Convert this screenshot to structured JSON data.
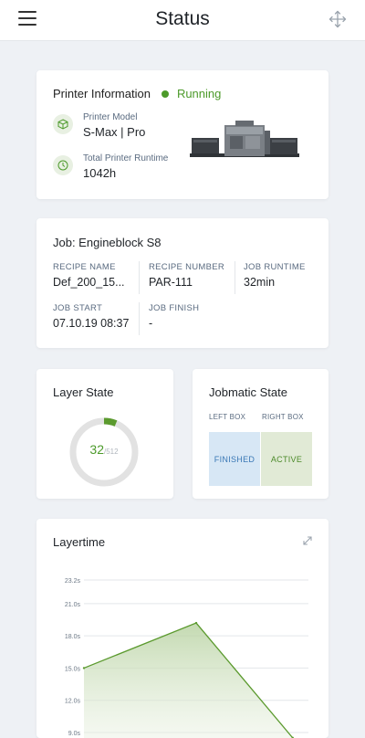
{
  "header": {
    "title": "Status",
    "menu_icon": "hamburger-icon",
    "right_icon": "move-arrows-icon"
  },
  "printer": {
    "title": "Printer Information",
    "status": "Running",
    "status_color": "#4c9a2a",
    "model_label": "Printer Model",
    "model_value": "S-Max | Pro",
    "runtime_label": "Total Printer Runtime",
    "runtime_value": "1042h"
  },
  "job": {
    "title": "Job: Engineblock S8",
    "recipe_name_label": "RECIPE NAME",
    "recipe_name_value": "Def_200_15...",
    "recipe_number_label": "RECIPE NUMBER",
    "recipe_number_value": "PAR-111",
    "job_runtime_label": "JOB RUNTIME",
    "job_runtime_value": "32min",
    "job_start_label": "JOB START",
    "job_start_value": "07.10.19 08:37",
    "job_finish_label": "JOB FINISH",
    "job_finish_value": "-"
  },
  "layer_state": {
    "title": "Layer State",
    "current": "32",
    "total": "/512",
    "progress_fraction": 0.0625
  },
  "jobmatic": {
    "title": "Jobmatic State",
    "left_label": "LEFT BOX",
    "right_label": "RIGHT BOX",
    "left_state": "FINISHED",
    "right_state": "ACTIVE"
  },
  "layertime": {
    "title": "Layertime",
    "expand_icon": "expand-icon"
  },
  "chart_data": {
    "type": "area",
    "title": "Layertime",
    "yticks": [
      "23.2s",
      "21.0s",
      "18.0s",
      "15.0s",
      "12.0s",
      "9.0s"
    ],
    "ylim": [
      9.0,
      23.2
    ],
    "x": [
      0,
      1,
      2
    ],
    "values": [
      15.0,
      19.2,
      8.5
    ],
    "color": "#5b9a2e",
    "grid": true
  }
}
